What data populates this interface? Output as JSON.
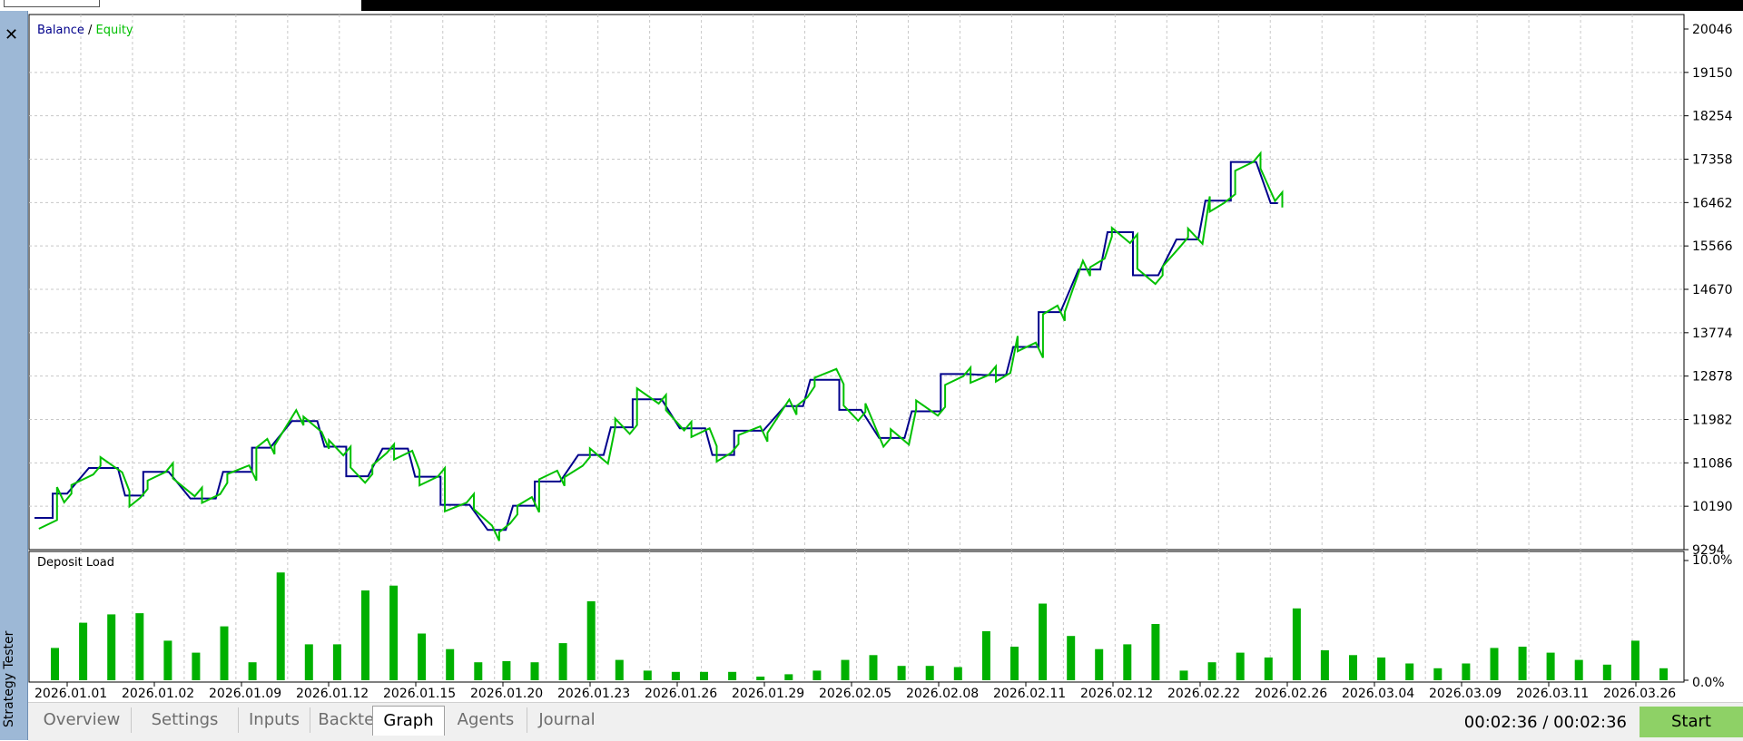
{
  "sidebar": {
    "label": "Strategy Tester",
    "close_symbol": "✕"
  },
  "colors": {
    "balance": "#00008b",
    "equity": "#00c000",
    "deposit_bar": "#00b000",
    "grid": "#c8c8c8",
    "sidebar_bg": "#9db8d6",
    "start_button": "#8ed166"
  },
  "chart_data": [
    {
      "type": "line",
      "legend": {
        "balance": "Balance",
        "separator": " / ",
        "equity": "Equity"
      },
      "y_ticks": [
        20046,
        19150,
        18254,
        17358,
        16462,
        15566,
        14670,
        13774,
        12878,
        11982,
        11086,
        10190,
        9294
      ],
      "ylim": [
        9294,
        20046
      ],
      "x_count": 155,
      "balance_series": {
        "name": "Balance",
        "x": [
          0,
          5,
          5,
          7,
          9,
          9,
          15,
          17,
          17,
          23,
          25,
          25,
          28,
          30,
          30,
          35,
          37,
          37,
          43,
          45,
          45,
          50,
          52,
          52,
          58,
          60,
          60,
          63,
          65,
          65,
          71,
          73,
          73,
          78,
          80,
          80,
          84,
          86,
          86,
          90,
          92,
          92,
          96,
          98,
          98,
          103,
          105,
          105,
          110,
          112,
          112,
          118,
          120,
          120,
          125,
          127,
          127,
          130,
          132,
          132,
          136,
          138,
          138,
          143,
          145,
          145,
          150,
          152,
          152,
          157,
          159,
          159,
          163,
          165,
          165,
          171,
          173,
          173,
          178,
          180,
          180,
          185,
          187,
          187,
          191,
          193,
          193,
          199,
          201,
          201,
          207,
          209,
          209,
          212,
          214,
          214,
          220,
          222,
          222,
          226,
          228,
          228,
          233,
          235,
          235,
          240,
          242,
          242,
          248,
          250,
          250,
          255,
          257,
          257,
          262,
          264,
          264,
          268,
          270,
          270,
          275,
          277,
          277,
          281,
          283,
          283,
          288,
          290,
          290,
          294,
          296,
          296,
          301,
          303,
          303,
          308,
          310,
          310,
          315,
          317,
          317,
          321,
          323,
          323,
          327,
          330,
          330,
          335,
          337,
          337,
          341,
          343,
          343,
          348,
          350
        ],
        "values": [
          9950,
          9950,
          10450,
          10450,
          10450,
          10450,
          10980,
          10980,
          10980,
          10980,
          10410,
          10410,
          10410,
          10410,
          10900,
          10900,
          10900,
          10900,
          10350,
          10350,
          10350,
          10350,
          10900,
          10900,
          10900,
          10900,
          11400,
          11400,
          11400,
          11400,
          11950,
          11950,
          11950,
          11950,
          11420,
          11420,
          11420,
          11420,
          10810,
          10810,
          10810,
          10810,
          11380,
          11380,
          11380,
          11380,
          10800,
          10800,
          10800,
          10800,
          10220,
          10220,
          10220,
          10220,
          9700,
          9700,
          9700,
          9700,
          10200,
          10200,
          10200,
          10200,
          10700,
          10700,
          10700,
          10700,
          11250,
          11250,
          11250,
          11250,
          11820,
          11820,
          11820,
          11820,
          12400,
          12400,
          12400,
          12400,
          11800,
          11800,
          11800,
          11800,
          11250,
          11250,
          11250,
          11250,
          11750,
          11750,
          11750,
          11750,
          12260,
          12260,
          12260,
          12260,
          12800,
          12800,
          12800,
          12800,
          12180,
          12180,
          12180,
          12180,
          11600,
          11600,
          11600,
          11600,
          12150,
          12150,
          12150,
          12150,
          12920,
          12920,
          12920,
          12920,
          12900,
          12900,
          12900,
          12900,
          13480,
          13480,
          13480,
          13480,
          14200,
          14200,
          14200,
          14200,
          15080,
          15080,
          15080,
          15080,
          15850,
          15850,
          15850,
          15850,
          14960,
          14960,
          14960,
          14960,
          15700,
          15700,
          15700,
          15700,
          16500,
          16500,
          16500,
          16500,
          17300,
          17300,
          17300,
          17300,
          16450,
          16450,
          16450
        ],
        "note_x": "x indices along time axis"
      },
      "x_labels": [
        "2026.01.01",
        "2026.01.02",
        "2026.01.09",
        "2026.01.12",
        "2026.01.15",
        "2026.01.20",
        "2026.01.23",
        "2026.01.26",
        "2026.01.29",
        "2026.02.05",
        "2026.02.08",
        "2026.02.11",
        "2026.02.12",
        "2026.02.22",
        "2026.02.26",
        "2026.03.04",
        "2026.03.09",
        "2026.03.11",
        "2026.03.26"
      ]
    },
    {
      "type": "bar",
      "title": "Deposit Load",
      "y_ticks": [
        "10.0%",
        "0.0%"
      ],
      "ylim": [
        0,
        10
      ],
      "values": [
        2.7,
        4.8,
        5.5,
        5.6,
        3.3,
        2.3,
        4.5,
        1.5,
        9.0,
        3.0,
        3.0,
        7.5,
        7.9,
        3.9,
        2.6,
        1.5,
        1.6,
        1.5,
        3.1,
        6.6,
        1.7,
        0.8,
        0.7,
        0.7,
        0.7,
        0.3,
        0.5,
        0.8,
        1.7,
        2.1,
        1.2,
        1.2,
        1.1,
        4.1,
        2.8,
        6.4,
        3.7,
        2.6,
        3.0,
        4.7,
        0.8,
        1.5,
        2.3,
        1.9,
        6.0,
        2.5,
        2.1,
        1.9,
        1.4,
        1.0,
        1.4,
        2.7,
        2.8,
        2.3,
        1.7,
        1.3,
        3.3,
        1.0
      ]
    }
  ],
  "tabs": [
    {
      "label": "Overview",
      "active": false
    },
    {
      "label": "Settings",
      "active": false
    },
    {
      "label": "Inputs",
      "active": false
    },
    {
      "label": "Backtest",
      "active": false
    },
    {
      "label": "Graph",
      "active": true
    },
    {
      "label": "Agents",
      "active": false
    },
    {
      "label": "Journal",
      "active": false
    }
  ],
  "status": {
    "timer": "00:02:36 / 00:02:36",
    "start_label": "Start"
  }
}
